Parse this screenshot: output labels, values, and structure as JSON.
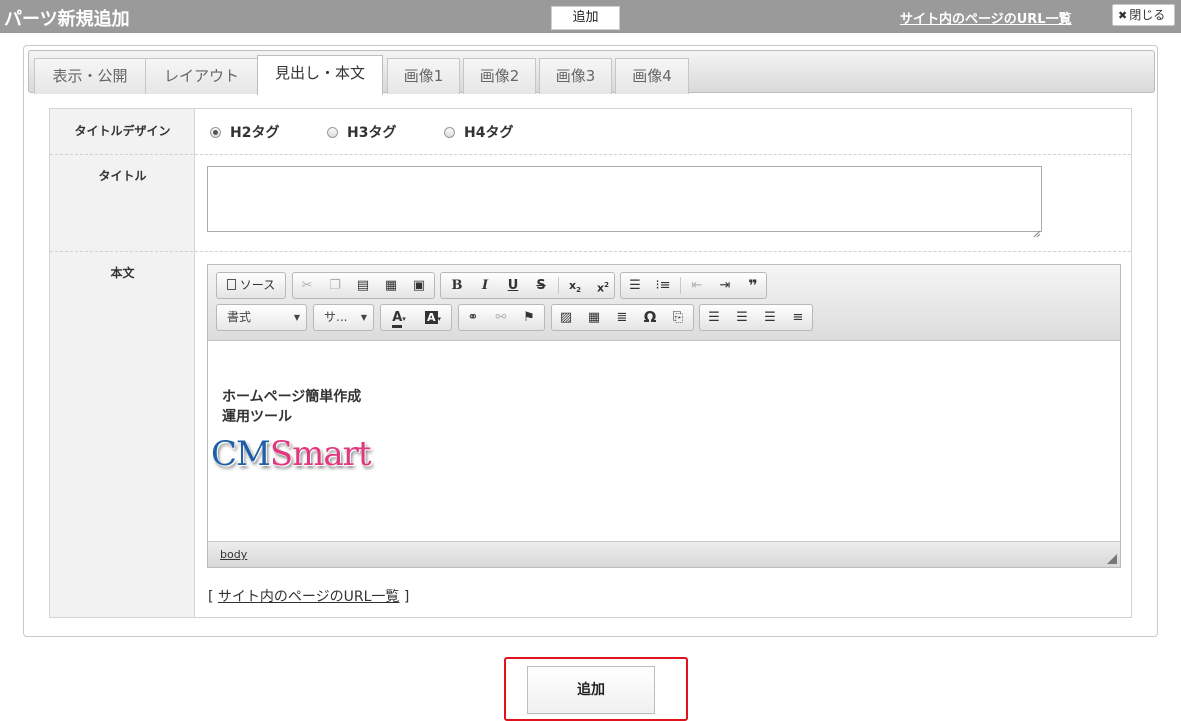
{
  "header": {
    "title": "パーツ新規追加",
    "add_label": "追加",
    "url_list_link": "サイト内のページのURL一覧",
    "close_icon": "close-x-icon",
    "close_label": "閉じる"
  },
  "tabs": [
    {
      "label": "表示・公開",
      "active": false
    },
    {
      "label": "レイアウト",
      "active": false
    },
    {
      "label": "見出し・本文",
      "active": true
    },
    {
      "label": "画像1",
      "active": false
    },
    {
      "label": "画像2",
      "active": false
    },
    {
      "label": "画像3",
      "active": false
    },
    {
      "label": "画像4",
      "active": false
    }
  ],
  "form": {
    "title_design_label": "タイトルデザイン",
    "title_design_options": [
      {
        "label": "H2タグ",
        "selected": true
      },
      {
        "label": "H3タグ",
        "selected": false
      },
      {
        "label": "H4タグ",
        "selected": false
      }
    ],
    "title_label": "タイトル",
    "title_value": "",
    "body_label": "本文"
  },
  "editor": {
    "source_label": "ソース",
    "format_combo": "書式",
    "size_combo": "サ...",
    "toolbar_icons": [
      "source-icon",
      "cut-icon",
      "copy-icon",
      "paste-icon",
      "paste-text-icon",
      "paste-word-icon",
      "bold-icon",
      "italic-icon",
      "underline-icon",
      "strike-icon",
      "subscript-icon",
      "superscript-icon",
      "numbered-list-icon",
      "bulleted-list-icon",
      "outdent-icon",
      "indent-icon",
      "blockquote-icon",
      "text-color-icon",
      "bg-color-icon",
      "link-icon",
      "unlink-icon",
      "anchor-icon",
      "image-icon",
      "table-icon",
      "horizontal-rule-icon",
      "special-char-icon",
      "page-break-icon",
      "align-left-icon",
      "align-center-icon",
      "align-right-icon",
      "justify-icon"
    ],
    "content": {
      "line1": "ホームページ簡単作成",
      "line2": "運用ツール",
      "logo_part1": "CM",
      "logo_part2": "Smart"
    },
    "status_path": "body"
  },
  "url_line": {
    "open": "[",
    "link": "サイト内のページのURL一覧",
    "close": "]"
  },
  "footer": {
    "add_label": "追加"
  },
  "colors": {
    "header_bg": "#9a9a9a",
    "highlight": "#e0131d",
    "logo_blue": "#1e5fa8",
    "logo_pink": "#e0377f"
  }
}
